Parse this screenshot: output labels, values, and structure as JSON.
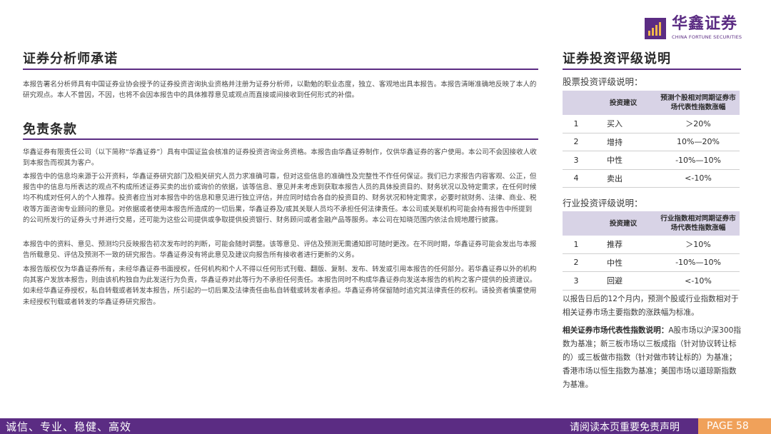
{
  "logo": {
    "name_cn": "华鑫证券",
    "name_en": "CHINA FORTUNE SECURITIES"
  },
  "left": {
    "analyst_title": "证券分析师承诺",
    "analyst_text": "本报告署名分析师具有中国证券业协会授予的证券投资咨询执业资格并注册为证券分析师，以勤勉的职业态度，独立、客观地出具本报告。本报告清晰准确地反映了本人的研究观点。本人不曾因，不因，也将不会因本报告中的具体推荐意见或观点而直接或间接收到任何形式的补偿。",
    "disclaimer_title": "免责条款",
    "disclaimer_paras": [
      "华鑫证券有限责任公司（以下简称“华鑫证券”）具有中国证监会核准的证券投资咨询业务资格。本报告由华鑫证券制作，仅供华鑫证券的客户使用。本公司不会因接收人收到本报告而视其为客户。",
      "本报告中的信息均来源于公开资料，华鑫证券研究部门及相关研究人员力求准确可靠，但对这些信息的准确性及完整性不作任何保证。我们已力求报告内容客观、公正，但报告中的信息与所表达的观点不构成所述证券买卖的出价或询价的依据，该等信息、意见并未考虑到获取本报告人员的具体投资目的、财务状况以及特定需求，在任何时候均不构成对任何人的个人推荐。投资者应当对本报告中的信息和意见进行独立评估，并应同时结合各自的投资目的、财务状况和特定需求，必要时就财务、法律、商业、税收等方面咨询专业顾问的意见。对依据或者使用本报告所造成的一切后果，华鑫证券及/或其关联人员均不承担任何法律责任。本公司或关联机构可能会持有报告中所提到的公司所发行的证券头寸并进行交易，还可能为这些公司提供或争取提供投资银行、财务顾问或者金融产品等服务。本公司在知晓范围内依法合规地履行披露。",
      "本报告中的资料、意见、预测均只反映报告初次发布时的判断，可能会随时调整。该等意见、评估及预测无需通知即可随时更改。在不同时期，华鑫证券可能会发出与本报告所载意见、评估及预测不一致的研究报告。华鑫证券没有将此意见及建议向报告所有接收者进行更新的义务。",
      "本报告版权仅为华鑫证券所有，未经华鑫证券书面授权，任何机构和个人不得以任何形式刊载、翻版、复制、发布、转发或引用本报告的任何部分。若华鑫证券以外的机构向其客户发放本报告，则由该机构独自为此发送行为负责，华鑫证券对此等行为不承担任何责任。本报告同时不构成华鑫证券向发送本报告的机构之客户提供的投资建议。如未经华鑫证券授权，私自转载或者转发本报告，所引起的一切后果及法律责任由私自转载或转发者承担。华鑫证券将保留随时追究其法律责任的权利。请投资者慎重使用未经授权刊载或者转发的华鑫证券研究报告。"
    ]
  },
  "right": {
    "title": "证券投资评级说明",
    "stock_label": "股票投资评级说明：",
    "stock_table": {
      "headers": [
        "",
        "投资建议",
        "预测个股相对同期证券市场代表性指数涨幅"
      ],
      "rows": [
        [
          "1",
          "买入",
          "＞20%"
        ],
        [
          "2",
          "增持",
          "10%—20%"
        ],
        [
          "3",
          "中性",
          "-10%—10%"
        ],
        [
          "4",
          "卖出",
          "<-10%"
        ]
      ]
    },
    "industry_label": "行业投资评级说明：",
    "industry_table": {
      "headers": [
        "",
        "投资建议",
        "行业指数相对同期证券市场代表性指数涨幅"
      ],
      "rows": [
        [
          "1",
          "推荐",
          "＞10%"
        ],
        [
          "2",
          "中性",
          "-10%—10%"
        ],
        [
          "3",
          "回避",
          "<-10%"
        ]
      ]
    },
    "note1": "以报告日后的12个月内，预测个股或行业指数相对于相关证券市场主要指数的涨跌幅为标准。",
    "note2_bold": "相关证券市场代表性指数说明：",
    "note2": "A股市场以沪深300指数为基准；新三板市场以三板成指（针对协议转让标的）或三板做市指数（针对做市转让标的）为基准；香港市场以恒生指数为基准；美国市场以道琼斯指数为基准。"
  },
  "footer": {
    "slogan": "诚信、专业、稳健、高效",
    "notice": "请阅读本页重要免责声明",
    "page": "PAGE 58"
  },
  "colors": {
    "brand_purple": "#5b2c83",
    "table_header": "#d8d3e6",
    "page_badge": "#f0a15a"
  }
}
